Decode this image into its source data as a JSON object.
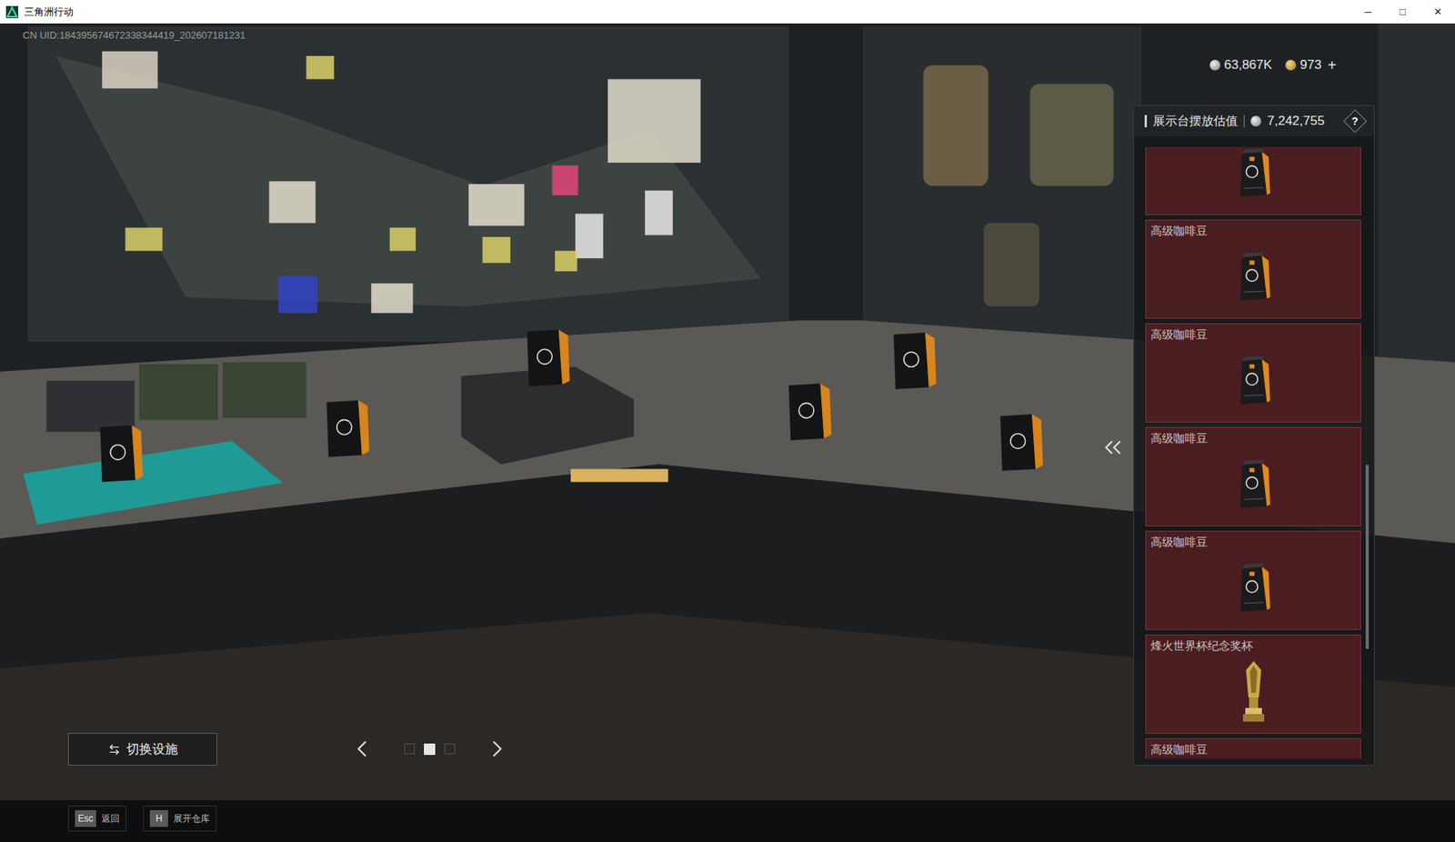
{
  "window": {
    "title": "三角洲行动",
    "controls": [
      "─",
      "□",
      "✕"
    ]
  },
  "uid": "CN UID:184395674672338344419_202607181231",
  "currency": [
    {
      "amount": "63,867K",
      "kind": "silver"
    },
    {
      "amount": "973",
      "kind": "gold"
    }
  ],
  "currency_add": "+",
  "display_panel": {
    "title": "展示台摆放估值",
    "value": "7,242,755",
    "help": "?",
    "scrollbar": {
      "offset": 0.52,
      "size": 0.3
    },
    "items": [
      {
        "name": "",
        "icon": "coffee"
      },
      {
        "name": "高级咖啡豆",
        "icon": "coffee"
      },
      {
        "name": "高级咖啡豆",
        "icon": "coffee"
      },
      {
        "name": "高级咖啡豆",
        "icon": "coffee"
      },
      {
        "name": "高级咖啡豆",
        "icon": "coffee"
      },
      {
        "name": "烽火世界杯纪念奖杯",
        "icon": "trophy"
      },
      {
        "name": "高级咖啡豆",
        "icon": "coffee"
      }
    ]
  },
  "switch_button": "切换设施",
  "pager": {
    "pages": [
      {
        "selected": false
      },
      {
        "selected": true
      },
      {
        "selected": false
      }
    ]
  },
  "hints": [
    {
      "key": "Esc",
      "label": "返回"
    },
    {
      "key": "H",
      "label": "展开仓库"
    }
  ]
}
